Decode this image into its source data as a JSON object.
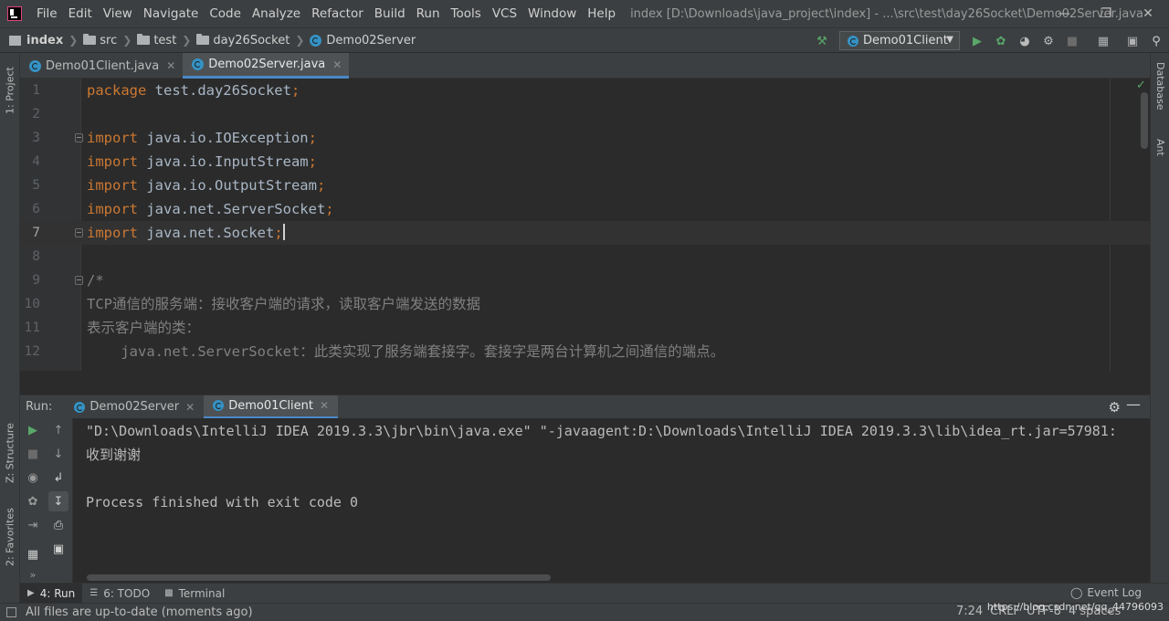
{
  "menu": {
    "items": [
      "File",
      "Edit",
      "View",
      "Navigate",
      "Code",
      "Analyze",
      "Refactor",
      "Build",
      "Run",
      "Tools",
      "VCS",
      "Window",
      "Help"
    ],
    "window_title": "index [D:\\Downloads\\java_project\\index] - ...\\src\\test\\day26Socket\\Demo02Server.java"
  },
  "breadcrumb": {
    "root": "index",
    "items": [
      "src",
      "test",
      "day26Socket",
      "Demo02Server"
    ]
  },
  "toolbar": {
    "run_config": "Demo01Client"
  },
  "editor_tabs": [
    {
      "label": "Demo01Client.java"
    },
    {
      "label": "Demo02Server.java"
    }
  ],
  "code": {
    "lines": [
      {
        "n": "1",
        "parts": [
          [
            "kw",
            "package "
          ],
          [
            "tx",
            "test.day26Socket"
          ],
          [
            "kw",
            ";"
          ]
        ]
      },
      {
        "n": "2",
        "parts": []
      },
      {
        "n": "3",
        "parts": [
          [
            "kw",
            "import "
          ],
          [
            "tx",
            "java.io.IOException"
          ],
          [
            "kw",
            ";"
          ]
        ]
      },
      {
        "n": "4",
        "parts": [
          [
            "kw",
            "import "
          ],
          [
            "tx",
            "java.io.InputStream"
          ],
          [
            "kw",
            ";"
          ]
        ]
      },
      {
        "n": "5",
        "parts": [
          [
            "kw",
            "import "
          ],
          [
            "tx",
            "java.io.OutputStream"
          ],
          [
            "kw",
            ";"
          ]
        ]
      },
      {
        "n": "6",
        "parts": [
          [
            "kw",
            "import "
          ],
          [
            "tx",
            "java.net.ServerSocket"
          ],
          [
            "kw",
            ";"
          ]
        ]
      },
      {
        "n": "7",
        "parts": [
          [
            "kw",
            "import "
          ],
          [
            "tx",
            "java.net.Socket"
          ],
          [
            "kw",
            ";"
          ]
        ]
      },
      {
        "n": "8",
        "parts": []
      },
      {
        "n": "9",
        "parts": [
          [
            "cm",
            "/*"
          ]
        ]
      },
      {
        "n": "10",
        "parts": [
          [
            "cm",
            "TCP通信的服务端：接收客户端的请求，读取客户端发送的数据"
          ]
        ]
      },
      {
        "n": "11",
        "parts": [
          [
            "cm",
            "表示客户端的类："
          ]
        ]
      },
      {
        "n": "12",
        "parts": [
          [
            "cm",
            "    java.net.ServerSocket：此类实现了服务端套接字。套接字是两台计算机之间通信的端点。"
          ]
        ]
      }
    ]
  },
  "run_panel": {
    "label": "Run:",
    "tabs": [
      {
        "label": "Demo02Server"
      },
      {
        "label": "Demo01Client"
      }
    ],
    "console": [
      "\"D:\\Downloads\\IntelliJ IDEA 2019.3.3\\jbr\\bin\\java.exe\" \"-javaagent:D:\\Downloads\\IntelliJ IDEA 2019.3.3\\lib\\idea_rt.jar=57981:",
      "收到谢谢",
      "",
      "Process finished with exit code 0"
    ]
  },
  "side_tabs": {
    "project": "1: Project",
    "structure": "Z: Structure",
    "favorites": "2: Favorites",
    "database": "Database",
    "ant": "Ant"
  },
  "bottom_tools": {
    "run": "4: Run",
    "todo": "6: TODO",
    "terminal": "Terminal",
    "event_log": "Event Log"
  },
  "status": {
    "message": "All files are up-to-date (moments ago)",
    "position": "7:24",
    "line_sep": "CRLF",
    "encoding": "UTF-8",
    "indent": "4 spaces",
    "watermark": "https://blog.csdn.net/qq_44796093"
  },
  "colors": {
    "keyword": "#cc7832",
    "identifier": "#a9b7c6",
    "comment": "#808080",
    "run_green": "#59a869",
    "accent": "#4a88c7"
  }
}
